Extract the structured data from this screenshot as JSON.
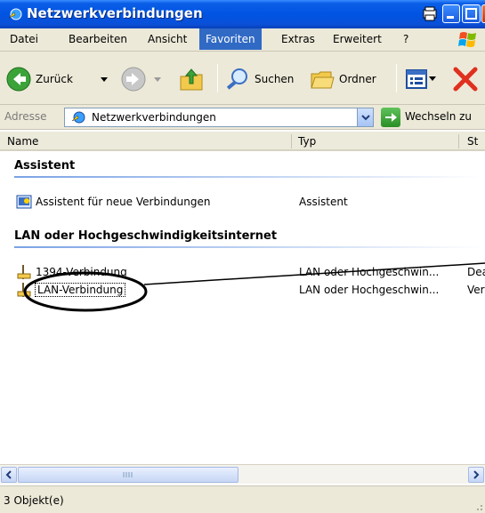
{
  "window": {
    "title": "Netzwerkverbindungen"
  },
  "menu": {
    "items": [
      {
        "label": "Datei"
      },
      {
        "label": "Bearbeiten"
      },
      {
        "label": "Ansicht"
      },
      {
        "label": "Favoriten",
        "active": true
      },
      {
        "label": "Extras"
      },
      {
        "label": "Erweitert"
      },
      {
        "label": "?"
      }
    ]
  },
  "toolbar": {
    "back": "Zurück",
    "search": "Suchen",
    "folders": "Ordner"
  },
  "address": {
    "label": "Adresse",
    "value": "Netzwerkverbindungen",
    "go": "Wechseln zu"
  },
  "columns": {
    "name": "Name",
    "type": "Typ",
    "status": "St"
  },
  "groups": {
    "assistant": {
      "title": "Assistent",
      "items": [
        {
          "name": "Assistent für neue Verbindungen",
          "type": "Assistent"
        }
      ]
    },
    "lan": {
      "title": "LAN oder Hochgeschwindigkeitsinternet",
      "items": [
        {
          "name": "1394-Verbindung",
          "type": "LAN oder Hochgeschwin...",
          "status": "Dea"
        },
        {
          "name": "LAN-Verbindung",
          "type": "LAN oder Hochgeschwin...",
          "status": "Ver"
        }
      ]
    }
  },
  "status": {
    "text": "3 Objekt(e)"
  },
  "colors": {
    "title_blue": "#0054e3",
    "menu_highlight": "#316ac5",
    "chrome": "#ece9d8"
  }
}
